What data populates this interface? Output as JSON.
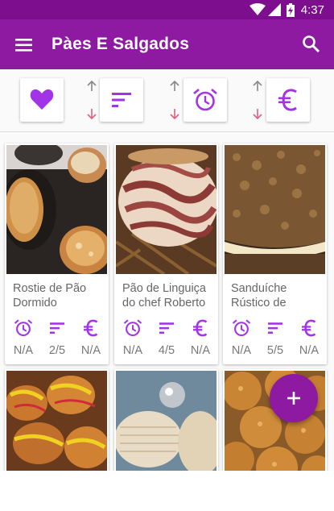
{
  "status_bar": {
    "time": "4:37"
  },
  "app_bar": {
    "title": "Pàes E Salgados"
  },
  "colors": {
    "primary": "#8e1aa2",
    "status": "#7d0f8f",
    "accent": "#a333e6",
    "down_arrow": "#e06080"
  },
  "filters": [
    {
      "name": "favorites",
      "icon": "heart-icon"
    },
    {
      "name": "sort-rating",
      "icon": "sort-icon"
    },
    {
      "name": "sort-time",
      "icon": "alarm-icon"
    },
    {
      "name": "sort-price",
      "icon": "euro-icon"
    }
  ],
  "recipes": [
    {
      "name": "Rostie de Pão Dormido",
      "time": "N/A",
      "rating": "2/5",
      "price": "N/A"
    },
    {
      "name": "Pão de Linguiça do chef Roberto",
      "time": "N/A",
      "rating": "4/5",
      "price": "N/A"
    },
    {
      "name": "Sanduíche Rústico de",
      "time": "N/A",
      "rating": "5/5",
      "price": "N/A"
    },
    {
      "name": ""
    },
    {
      "name": ""
    },
    {
      "name": ""
    }
  ]
}
